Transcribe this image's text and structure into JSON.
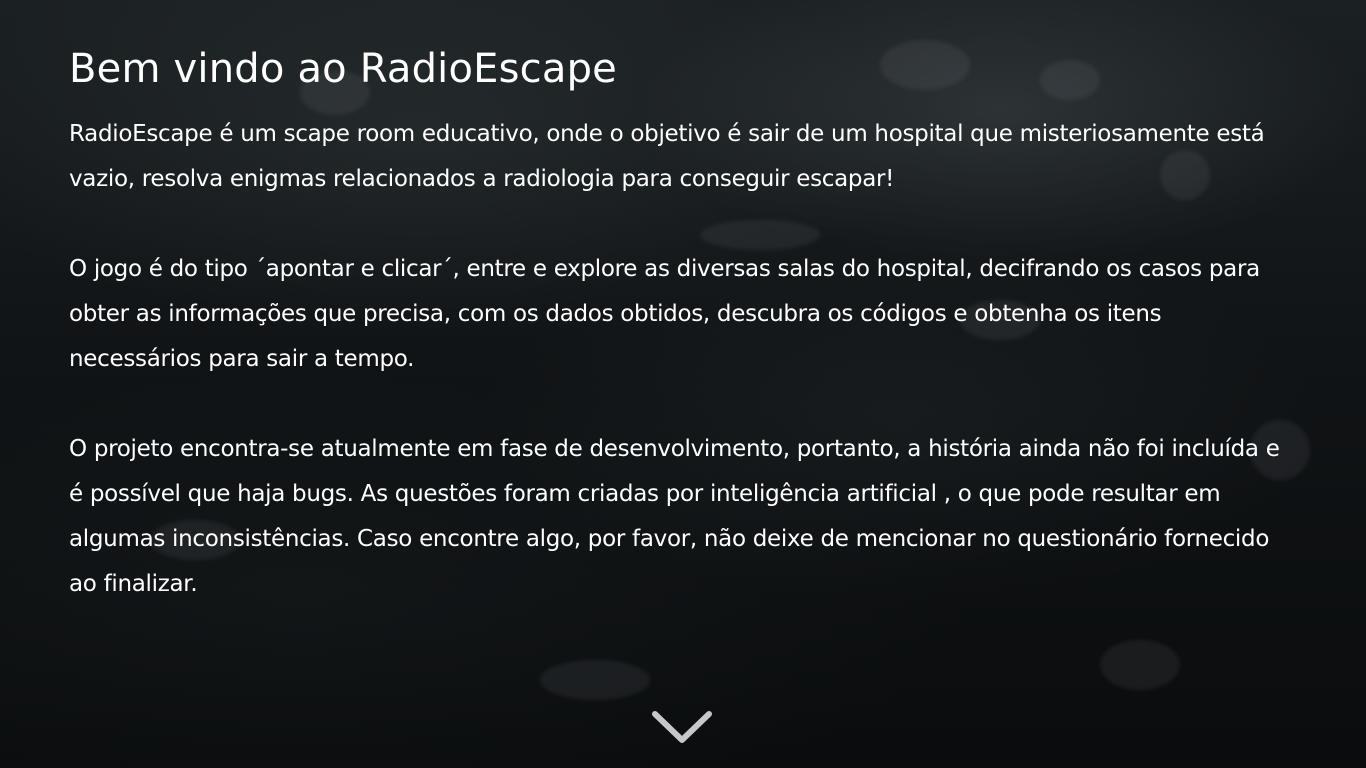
{
  "welcome": {
    "title": "Bem vindo ao RadioEscape",
    "paragraphs": [
      "RadioEscape  é um scape room educativo, onde o objetivo é sair de um hospital que misteriosamente está vazio, resolva enigmas relacionados a radiologia para conseguir escapar!",
      "O jogo é do tipo ´apontar e clicar´, entre e explore as diversas salas do hospital, decifrando os casos para obter as informações que precisa, com os dados obtidos, descubra os códigos e obtenha os itens necessários para sair a tempo.",
      "O projeto encontra-se atualmente em fase de desenvolvimento, portanto, a história ainda não foi incluída e é possível que haja bugs. As questões foram criadas por inteligência artificial , o que pode resultar em algumas inconsistências. Caso encontre algo, por favor, não deixe de mencionar no questionário fornecido ao finalizar."
    ]
  },
  "icons": {
    "scroll_down": "chevron-down-icon"
  },
  "colors": {
    "text": "#ffffff",
    "chevron": "#c8c8c8"
  }
}
